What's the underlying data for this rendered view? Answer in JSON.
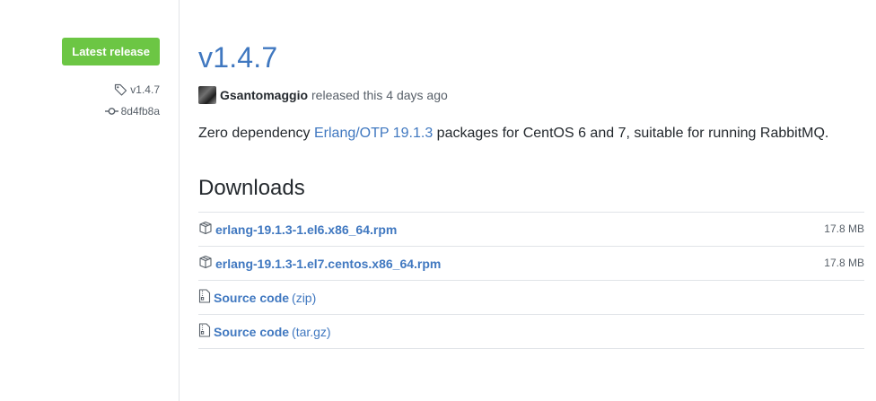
{
  "sidebar": {
    "badge": "Latest release",
    "tag": "v1.4.7",
    "commit": "8d4fb8a"
  },
  "release": {
    "title": "v1.4.7",
    "author": "Gsantomaggio",
    "released_text": "released this 4 days ago",
    "description": {
      "before": "Zero dependency ",
      "link": "Erlang/OTP 19.1.3",
      "after": " packages for CentOS 6 and 7, suitable for running RabbitMQ."
    }
  },
  "downloads": {
    "heading": "Downloads",
    "items": [
      {
        "name": "erlang-19.1.3-1.el6.x86_64.rpm",
        "size": "17.8 MB"
      },
      {
        "name": "erlang-19.1.3-1.el7.centos.x86_64.rpm",
        "size": "17.8 MB"
      },
      {
        "name": "Source code",
        "suffix": "(zip)"
      },
      {
        "name": "Source code",
        "suffix": "(tar.gz)"
      }
    ]
  },
  "icons": {
    "tag": "tag-icon",
    "commit": "commit-icon",
    "package": "package-icon",
    "archive": "file-zip-icon"
  },
  "colors": {
    "badge": "#6cc644",
    "link": "#4078c0",
    "muted": "#586069",
    "border": "#e1e4e8"
  }
}
